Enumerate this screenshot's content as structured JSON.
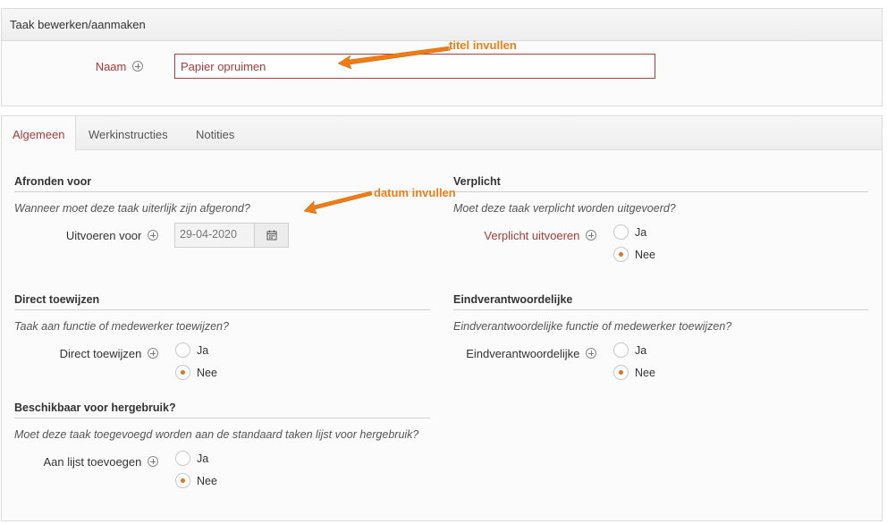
{
  "top_panel": {
    "title": "Taak bewerken/aanmaken",
    "naam_label": "Naam",
    "naam_value": "Papier opruimen"
  },
  "tabs": [
    {
      "label": "Algemeen",
      "active": true
    },
    {
      "label": "Werkinstructies",
      "active": false
    },
    {
      "label": "Notities",
      "active": false
    }
  ],
  "sections": {
    "afronden": {
      "title": "Afronden voor",
      "question": "Wanneer moet deze taak uiterlijk zijn afgerond?",
      "field_label": "Uitvoeren voor",
      "date_value": "29-04-2020"
    },
    "verplicht": {
      "title": "Verplicht",
      "question": "Moet deze taak verplicht worden uitgevoerd?",
      "field_label": "Verplicht uitvoeren",
      "options": [
        "Ja",
        "Nee"
      ],
      "selected": "Nee"
    },
    "direct": {
      "title": "Direct toewijzen",
      "question": "Taak aan functie of medewerker toewijzen?",
      "field_label": "Direct toewijzen",
      "options": [
        "Ja",
        "Nee"
      ],
      "selected": "Nee"
    },
    "eindverantwoordelijke": {
      "title": "Eindverantwoordelijke",
      "question": "Eindverantwoordelijke functie of medewerker toewijzen?",
      "field_label": "Eindverantwoordelijke",
      "options": [
        "Ja",
        "Nee"
      ],
      "selected": "Nee"
    },
    "hergebruik": {
      "title": "Beschikbaar voor hergebruik?",
      "question": "Moet deze taak toegevoegd worden aan de standaard taken lijst voor hergebruik?",
      "field_label": "Aan lijst toevoegen",
      "options": [
        "Ja",
        "Nee"
      ],
      "selected": "Nee"
    }
  },
  "annotations": {
    "titel": "titel invullen",
    "datum": "datum invullen"
  },
  "colors": {
    "accent_red": "#a83a3a",
    "annotation_orange": "#f07c14",
    "radio_dot": "#e8701a"
  }
}
